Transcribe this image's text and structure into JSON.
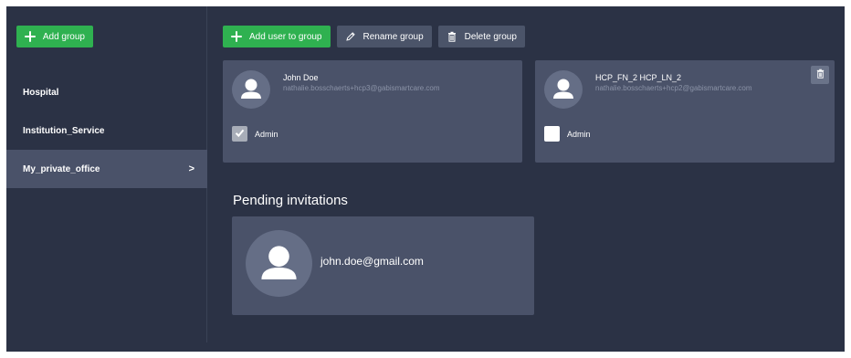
{
  "sidebar": {
    "add_group_label": "Add group",
    "groups": [
      {
        "label": "Hospital"
      },
      {
        "label": "Institution_Service"
      },
      {
        "label": "My_private_office",
        "selected": true,
        "chevron": ">"
      }
    ]
  },
  "toolbar": {
    "add_user_label": "Add user to group",
    "rename_label": "Rename group",
    "delete_label": "Delete group"
  },
  "members": [
    {
      "name": "John Doe",
      "email": "nathalie.bosschaerts+hcp3@gabismartcare.com",
      "admin_label": "Admin",
      "admin_checked": true
    },
    {
      "name": "HCP_FN_2 HCP_LN_2",
      "email": "nathalie.bosschaerts+hcp2@gabismartcare.com",
      "admin_label": "Admin",
      "admin_checked": false
    }
  ],
  "pending": {
    "title": "Pending invitations",
    "invitations": [
      {
        "email": "john.doe@gmail.com"
      }
    ]
  },
  "icons": {
    "add": "plus-icon",
    "rename": "pencil-icon",
    "delete": "trash-icon",
    "avatar": "user-icon",
    "check": "checkmark-icon"
  },
  "colors": {
    "background": "#2b3245",
    "card": "#4a5269",
    "primary_green": "#2fb150",
    "secondary_button": "#4b5469",
    "muted_text": "#8b93a7"
  }
}
